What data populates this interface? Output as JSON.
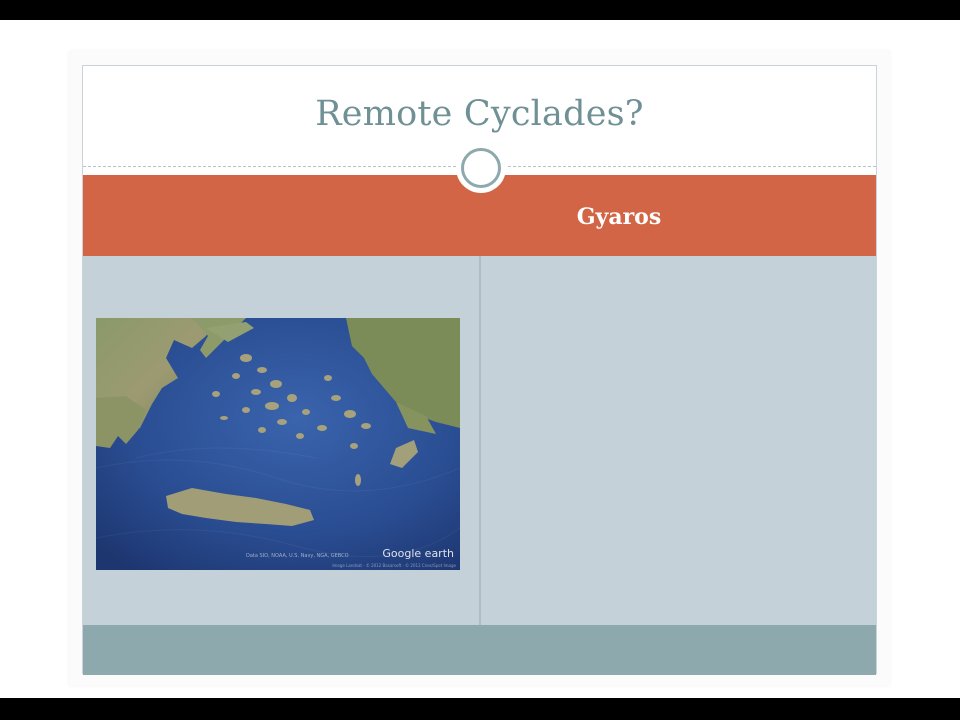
{
  "slide": {
    "title": "Remote Cyclades?",
    "header_label": "Gyaros"
  },
  "map": {
    "watermark": "Google earth",
    "caption": "Data SIO, NOAA, U.S. Navy, NGA, GEBCO",
    "credits": "Image Landsat · © 2012 Basarsoft · © 2012 Cnes/Spot Image"
  },
  "colors": {
    "title": "#6f9095",
    "band": "#d26545",
    "content_bg": "#c4d1d8",
    "footer": "#8ea9ad",
    "ring": "#8ea9ad"
  }
}
